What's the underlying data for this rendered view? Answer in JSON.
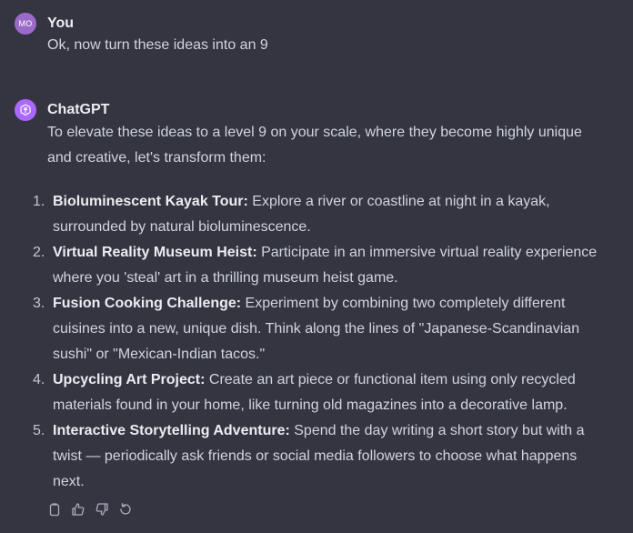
{
  "user_message": {
    "avatar_initials": "MO",
    "author": "You",
    "text": "Ok, now turn these ideas into an 9"
  },
  "assistant_message": {
    "author": "ChatGPT",
    "intro": "To elevate these ideas to a level 9 on your scale, where they become highly unique and creative, let's transform them:",
    "items": [
      {
        "num": "1.",
        "title": "Bioluminescent Kayak Tour:",
        "text": " Explore a river or coastline at night in a kayak, surrounded by natural bioluminescence."
      },
      {
        "num": "2.",
        "title": "Virtual Reality Museum Heist:",
        "text": " Participate in an immersive virtual reality experience where you 'steal' art in a thrilling museum heist game."
      },
      {
        "num": "3.",
        "title": "Fusion Cooking Challenge:",
        "text": " Experiment by combining two completely different cuisines into a new, unique dish. Think along the lines of \"Japanese-Scandinavian sushi\" or \"Mexican-Indian tacos.\""
      },
      {
        "num": "4.",
        "title": "Upcycling Art Project:",
        "text": " Create an art piece or functional item using only recycled materials found in your home, like turning old magazines into a decorative lamp."
      },
      {
        "num": "5.",
        "title": "Interactive Storytelling Adventure:",
        "text": " Spend the day writing a short story but with a twist — periodically ask friends or social media followers to choose what happens next."
      }
    ],
    "actions": [
      "copy-icon",
      "thumbs-up-icon",
      "thumbs-down-icon",
      "regenerate-icon"
    ]
  },
  "colors": {
    "background": "#343541",
    "user_avatar": "#9b6bc9",
    "assistant_avatar": "#ab68ff",
    "text": "#d1d5db"
  }
}
